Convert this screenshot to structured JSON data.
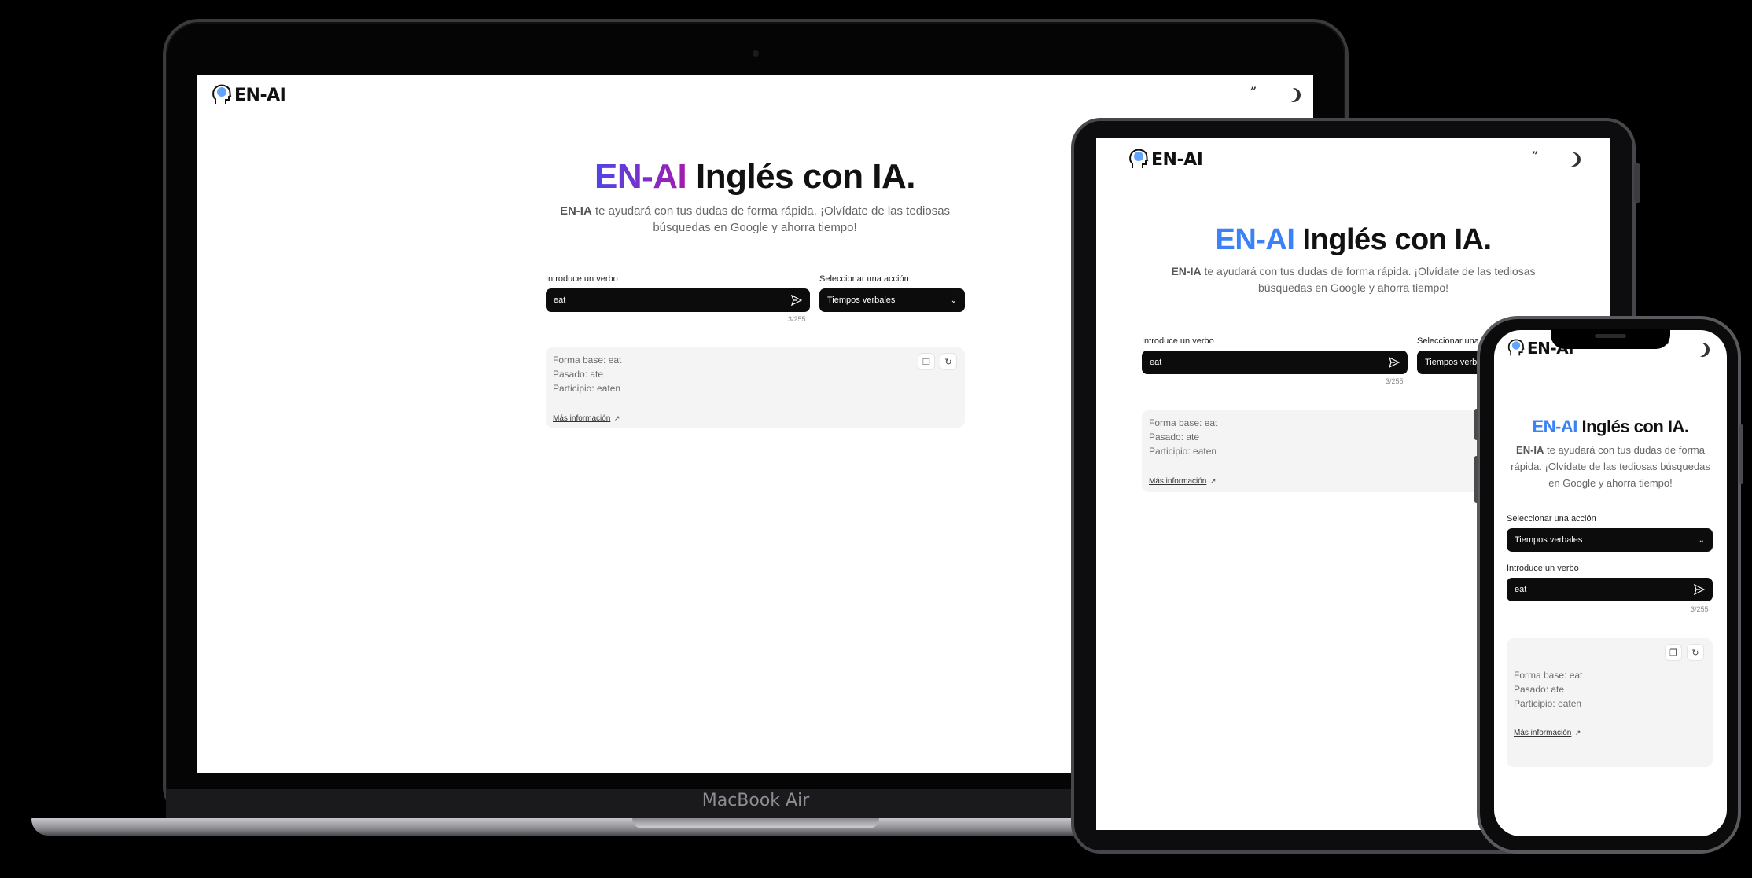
{
  "app": {
    "logo_text": "EN-AI",
    "hero_brand": "EN-AI",
    "hero_title_rest": " Inglés con IA.",
    "hero_sub_bold": "EN-IA",
    "hero_sub_rest": " te ayudará con tus dudas de forma rápida. ¡Olvídate de las tediosas búsquedas en Google y ahorra tiempo!",
    "verb_label": "Introduce un verbo",
    "verb_value": "eat",
    "char_counter": "3/255",
    "action_label": "Seleccionar una acción",
    "action_selected": "Tiempos verbales",
    "result_lines": [
      "Forma base: eat",
      "Pasado: ate",
      "Participio: eaten"
    ],
    "more_info_link": "Más información",
    "icons": {
      "send": "send-icon",
      "chevron": "chevron-down-icon",
      "copy": "copy-icon",
      "refresh": "refresh-icon",
      "external": "external-link-icon",
      "quote": "quote-icon",
      "theme": "moon-icon"
    }
  },
  "devices": {
    "laptop_label": "MacBook Air"
  },
  "colors": {
    "laptop_brand_gradient": [
      "#4f46e5",
      "#a21caf"
    ],
    "tablet_brand": "#3b82f6",
    "phone_brand": "#3b82f6",
    "field_bg": "#0c0c0c",
    "result_bg": "#f4f4f5"
  }
}
